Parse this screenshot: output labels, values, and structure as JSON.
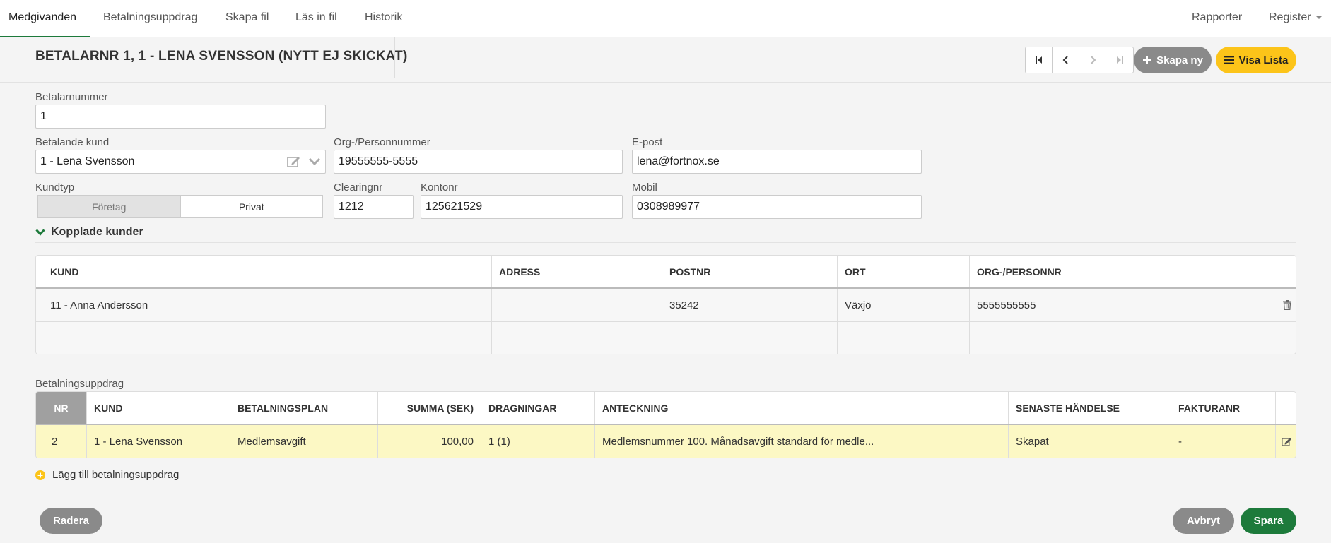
{
  "nav": {
    "tabs": [
      {
        "label": "Medgivanden",
        "active": true
      },
      {
        "label": "Betalningsuppdrag"
      },
      {
        "label": "Skapa fil"
      },
      {
        "label": "Läs in fil"
      },
      {
        "label": "Historik"
      }
    ],
    "right": [
      {
        "label": "Rapporter"
      },
      {
        "label": "Register"
      }
    ]
  },
  "header": {
    "title": "BETALARNR 1, 1 - LENA SVENSSON (NYTT EJ SKICKAT)",
    "create_label": "Skapa ny",
    "list_label": "Visa Lista"
  },
  "form": {
    "betalarnummer": {
      "label": "Betalarnummer",
      "value": "1"
    },
    "betalande_kund": {
      "label": "Betalande kund",
      "value": "1 - Lena Svensson"
    },
    "orgnr": {
      "label": "Org-/Personnummer",
      "value": "19555555-5555"
    },
    "epost": {
      "label": "E-post",
      "value": "lena@fortnox.se"
    },
    "kundtyp": {
      "label": "Kundtyp",
      "options": [
        "Företag",
        "Privat"
      ],
      "selected": "Företag"
    },
    "clearingnr": {
      "label": "Clearingnr",
      "value": "1212"
    },
    "kontonr": {
      "label": "Kontonr",
      "value": "125621529"
    },
    "mobil": {
      "label": "Mobil",
      "value": "0308989977"
    }
  },
  "kopplade": {
    "title": "Kopplade kunder",
    "columns": [
      "KUND",
      "ADRESS",
      "POSTNR",
      "ORT",
      "ORG-/PERSONNR"
    ],
    "rows": [
      {
        "kund": "11 - Anna Andersson",
        "adress": "",
        "postnr": "35242",
        "ort": "Växjö",
        "orgnr": "5555555555"
      }
    ]
  },
  "uppdrag": {
    "title": "Betalningsuppdrag",
    "columns": [
      "NR",
      "KUND",
      "BETALNINGSPLAN",
      "SUMMA (SEK)",
      "DRAGNINGAR",
      "ANTECKNING",
      "SENASTE HÄNDELSE",
      "FAKTURANR"
    ],
    "rows": [
      {
        "nr": "2",
        "kund": "1 - Lena Svensson",
        "plan": "Medlemsavgift",
        "summa": "100,00",
        "dragningar": "1 (1)",
        "anteckning": "Medlemsnummer 100. Månadsavgift standard för medle...",
        "handelse": "Skapat",
        "fakturanr": "-"
      }
    ],
    "add_label": "Lägg till betalningsuppdrag"
  },
  "footer": {
    "delete_label": "Radera",
    "cancel_label": "Avbryt",
    "save_label": "Spara"
  },
  "colors": {
    "accent_green": "#1d7a3b",
    "accent_yellow": "#fcc419",
    "row_highlight": "#fcf8c4"
  }
}
